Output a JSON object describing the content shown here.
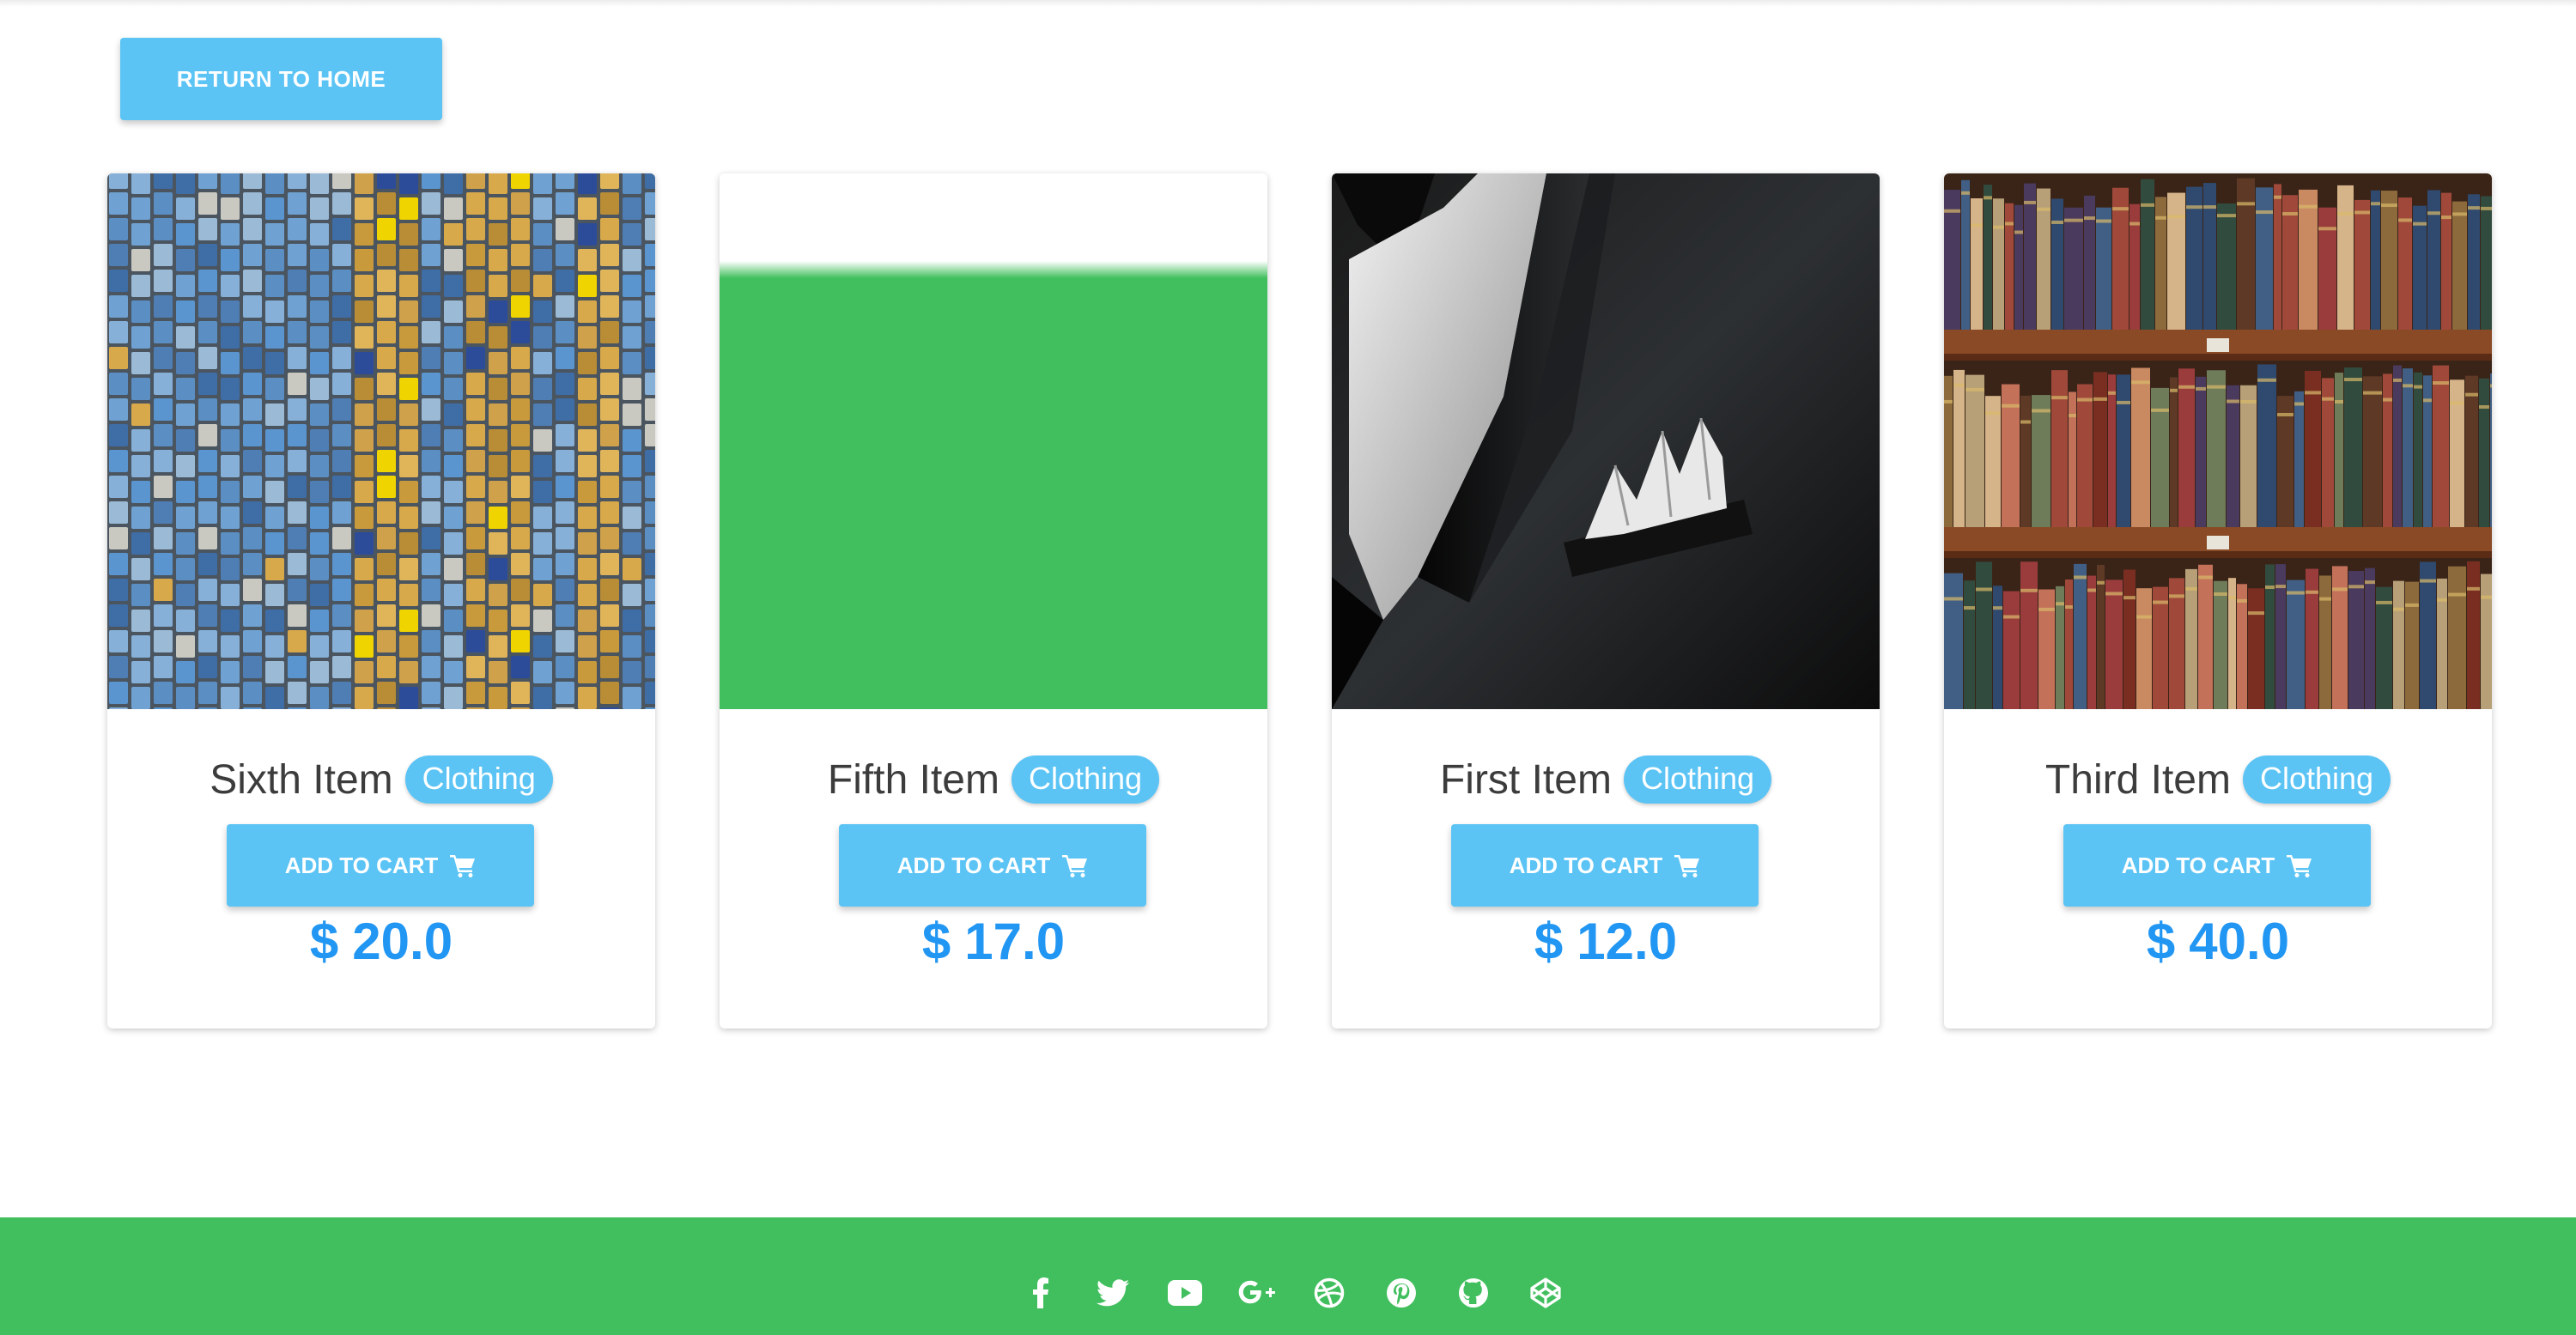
{
  "nav": {
    "return_label": "RETURN TO HOME"
  },
  "colors": {
    "accent": "#5bc4f5",
    "price": "#2196f3",
    "footer": "#41bf5e"
  },
  "products": [
    {
      "title": "Sixth Item",
      "category": "Clothing",
      "cart_label": "ADD TO CART",
      "currency": "$",
      "price": "20.0",
      "image": "blue-yellow-mosaic"
    },
    {
      "title": "Fifth Item",
      "category": "Clothing",
      "cart_label": "ADD TO CART",
      "currency": "$",
      "price": "17.0",
      "image": "green-placeholder"
    },
    {
      "title": "First Item",
      "category": "Clothing",
      "cart_label": "ADD TO CART",
      "currency": "$",
      "price": "12.0",
      "image": "suit-pocket-square"
    },
    {
      "title": "Third Item",
      "category": "Clothing",
      "cart_label": "ADD TO CART",
      "currency": "$",
      "price": "40.0",
      "image": "bookshelf"
    }
  ],
  "footer": {
    "social_icons": [
      "facebook-icon",
      "twitter-icon",
      "youtube-icon",
      "google-plus-icon",
      "dribbble-icon",
      "pinterest-icon",
      "github-icon",
      "codepen-icon"
    ]
  }
}
